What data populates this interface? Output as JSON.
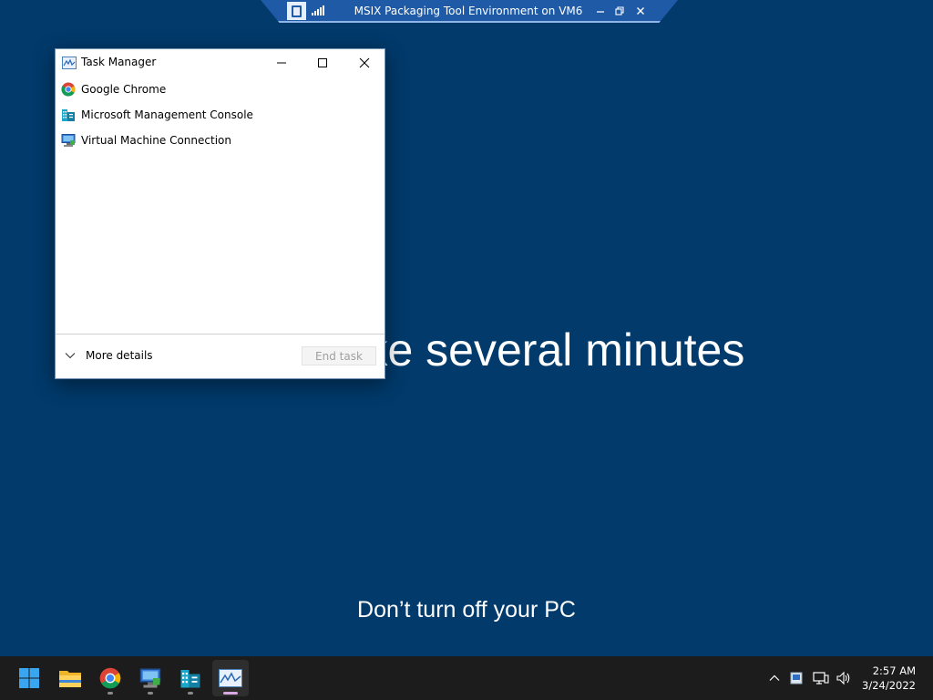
{
  "remote_bar": {
    "title": "MSIX Packaging Tool Environment on VM6",
    "controls": [
      "minimize-icon",
      "restore-icon",
      "close-icon"
    ]
  },
  "update_screen": {
    "message": "ake several minutes",
    "subtext": "Don’t turn off your PC"
  },
  "task_manager": {
    "title": "Task Manager",
    "apps": [
      {
        "label": "Google Chrome",
        "icon": "chrome-icon"
      },
      {
        "label": "Microsoft Management Console",
        "icon": "mmc-icon"
      },
      {
        "label": "Virtual Machine Connection",
        "icon": "vm-connection-icon"
      }
    ],
    "more_details_label": "More details",
    "end_task_label": "End task"
  },
  "taskbar": {
    "pinned": [
      "start-icon",
      "file-explorer-icon",
      "chrome-icon",
      "vm-connection-icon",
      "mmc-icon",
      "task-manager-icon"
    ],
    "tray": [
      "chevron-up-icon",
      "hyper-v-icon",
      "network-icon",
      "volume-icon"
    ],
    "time": "2:57 AM",
    "date": "3/24/2022"
  },
  "colors": {
    "desktop_background": "#013a6b",
    "remote_bar": "#1f5aa6",
    "taskbar": "#1c1c1c",
    "active_indicator": "#d8a9e0"
  }
}
